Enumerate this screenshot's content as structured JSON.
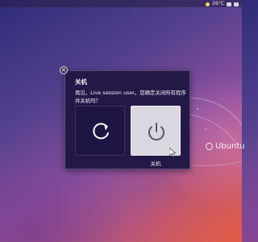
{
  "top_panel": {
    "status": "26°C",
    "icons": [
      "weather-icon",
      "battery-icon",
      "volume-icon",
      "power-menu-icon"
    ]
  },
  "desktop": {
    "brand_text": "Ubuntu",
    "colors": {
      "wallpaper_dark": "#2f2d78",
      "wallpaper_warm": "#d45d52"
    }
  },
  "dialog": {
    "title": "关机",
    "message": "再见，Live session user。您确定关闭所有程序并关机吗？",
    "close_icon": "close-icon",
    "options": [
      {
        "name": "restart",
        "icon": "restart-icon",
        "label": ""
      },
      {
        "name": "shutdown",
        "icon": "power-icon",
        "label": "关机"
      }
    ],
    "colors": {
      "background": "#241847",
      "selected_option": "#d9d7e0",
      "icon": "#5a5766"
    }
  }
}
